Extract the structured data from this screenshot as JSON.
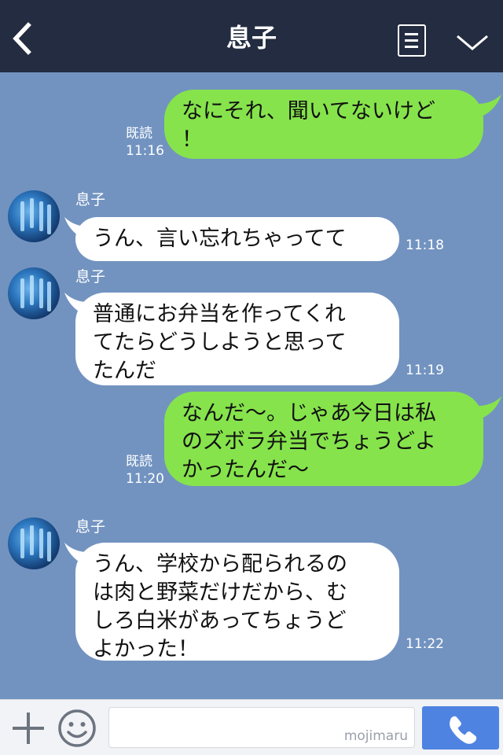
{
  "header": {
    "title": "息子"
  },
  "contact": {
    "name": "息子"
  },
  "messages": [
    {
      "side": "out",
      "text": "なにそれ、聞いてないけど\n！",
      "read": "既読",
      "time": "11:16"
    },
    {
      "side": "in",
      "text": "うん、言い忘れちゃってて",
      "time": "11:18"
    },
    {
      "side": "in",
      "text": "普通にお弁当を作ってくれ\nてたらどうしようと思って\nたんだ",
      "time": "11:19"
    },
    {
      "side": "out",
      "text": "なんだ〜。じゃあ今日は私\nのズボラ弁当でちょうどよ\nかったんだ〜",
      "read": "既読",
      "time": "11:20"
    },
    {
      "side": "in",
      "text": "うん、学校から配られるの\nは肉と野菜だけだから、む\nしろ白米があってちょうど\nよかった！",
      "time": "11:22"
    }
  ],
  "footer": {
    "watermark": "mojimaru"
  },
  "colors": {
    "background": "#7293c0",
    "header": "#232c40",
    "outgoing_bubble": "#86e34c",
    "incoming_bubble": "#ffffff",
    "call_button": "#4f83e2"
  },
  "icons": {
    "back": "chevron-left-icon",
    "menu": "list-icon",
    "collapse": "chevron-down-icon",
    "add": "plus-icon",
    "emoji": "smile-icon",
    "call": "phone-icon"
  }
}
